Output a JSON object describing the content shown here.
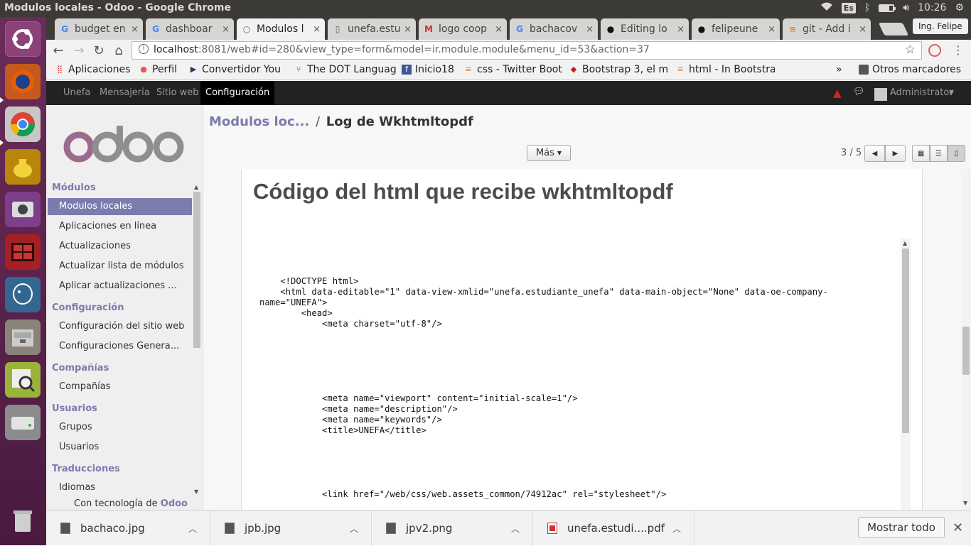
{
  "os_panel": {
    "window_title": "Modulos locales - Odoo - Google Chrome",
    "keyboard_layout": "Es",
    "time": "10:26",
    "battery_level": 0.7
  },
  "launcher": {
    "items": [
      "ubuntu-dash",
      "firefox",
      "chrome",
      "teapot-app",
      "webcam-app",
      "terminal-app",
      "postgres-app",
      "file-manager",
      "image-viewer",
      "disk-drive"
    ],
    "trash": "trash"
  },
  "browser": {
    "tabs": [
      {
        "label": "budget en",
        "icon": "google-icon"
      },
      {
        "label": "dashboar",
        "icon": "google-icon"
      },
      {
        "label": "Modulos l",
        "icon": "odoo-icon",
        "active": true
      },
      {
        "label": "unefa.estu",
        "icon": "page-icon"
      },
      {
        "label": "logo coop",
        "icon": "gmail-icon"
      },
      {
        "label": "bachacov",
        "icon": "google-icon"
      },
      {
        "label": "Editing lo",
        "icon": "github-icon"
      },
      {
        "label": "felipeune",
        "icon": "github-icon"
      },
      {
        "label": "git - Add i",
        "icon": "stackoverflow-icon"
      }
    ],
    "profile_name": "Ing. Felipe",
    "url_host": "localhost",
    "url_rest": ":8081/web#id=280&view_type=form&model=ir.module.module&menu_id=53&action=37",
    "bookmarks": [
      {
        "label": "Aplicaciones",
        "icon": "apps-icon"
      },
      {
        "label": "Perfil",
        "icon": "profile-icon"
      },
      {
        "label": "Convertidor You",
        "icon": "converter-icon"
      },
      {
        "label": "The DOT Languag",
        "icon": "graph-icon"
      },
      {
        "label": "Inicio18",
        "icon": "facebook-icon"
      },
      {
        "label": "css - Twitter Boot",
        "icon": "stackoverflow-icon"
      },
      {
        "label": "Bootstrap 3, el m",
        "icon": "bookmark-icon"
      },
      {
        "label": "html - In Bootstra",
        "icon": "stackoverflow-icon"
      }
    ],
    "bookmarks_overflow": "»",
    "other_bookmarks": "Otros marcadores"
  },
  "odoo": {
    "top_menu": [
      "Unefa",
      "Mensajería",
      "Sitio web",
      "Configuración"
    ],
    "active_menu": "Configuración",
    "user": "Administrator",
    "logo_text": "odoo",
    "sidebar": [
      {
        "heading": "Módulos",
        "items": [
          "Modulos locales",
          "Aplicaciones en línea",
          "Actualizaciones",
          "Actualizar lista de módulos",
          "Aplicar actualizaciones ..."
        ]
      },
      {
        "heading": "Configuración",
        "items": [
          "Configuración del sitio web",
          "Configuraciones Genera..."
        ]
      },
      {
        "heading": "Compañías",
        "items": [
          "Compañías"
        ]
      },
      {
        "heading": "Usuarios",
        "items": [
          "Grupos",
          "Usuarios"
        ]
      },
      {
        "heading": "Traducciones",
        "items": [
          "Idiomas"
        ]
      }
    ],
    "active_sidebar_item": "Modulos locales",
    "powered_prefix": "Con tecnología de",
    "powered_brand": "Odoo",
    "breadcrumb_root": "Modulos loc...",
    "breadcrumb_sep": "/",
    "breadcrumb_current": "Log de Wkhtmltopdf",
    "more_button": "Más",
    "pager": "3 / 5",
    "document_title": "Código del html que recibe wkhtmltopdf",
    "code_lines": [
      "    <!DOCTYPE html>",
      "    <html data-editable=\"1\" data-view-xmlid=\"unefa.estudiante_unefa\" data-main-object=\"None\" data-oe-company-",
      "name=\"UNEFA\">",
      "        <head>",
      "            <meta charset=\"utf-8\"/>",
      "            <meta name=\"viewport\" content=\"initial-scale=1\"/>",
      "            <meta name=\"description\"/>",
      "            <meta name=\"keywords\"/>",
      "            <title>UNEFA</title>",
      "            <link href=\"/web/css/web.assets_common/74912ac\" rel=\"stylesheet\"/>"
    ]
  },
  "downloads": {
    "items": [
      "bachaco.jpg",
      "jpb.jpg",
      "jpv2.png",
      "unefa.estudi....pdf"
    ],
    "show_all": "Mostrar todo"
  }
}
